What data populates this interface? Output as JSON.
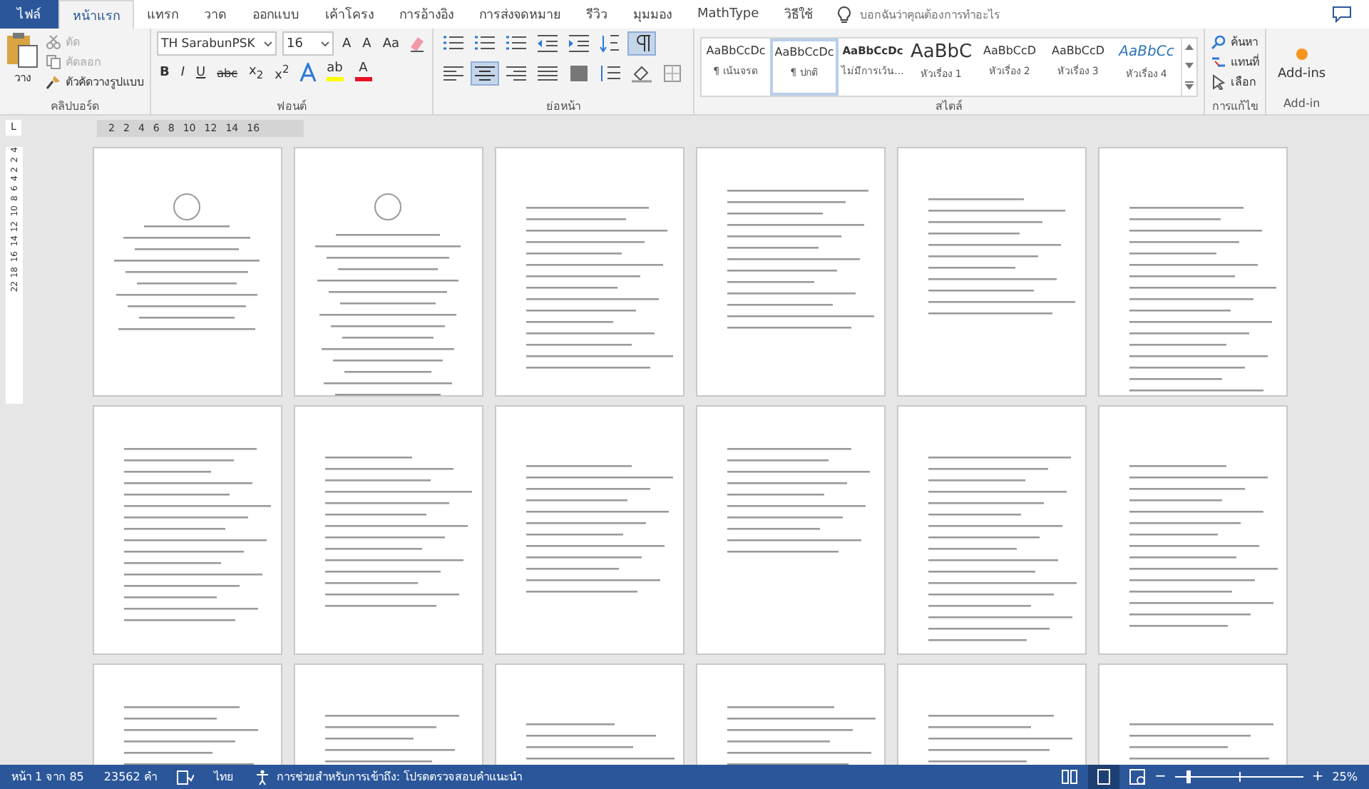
{
  "tabs": [
    {
      "label": "ไฟล์",
      "kind": "file",
      "selected": false
    },
    {
      "label": "หน้าแรก",
      "kind": "tab",
      "selected": true
    },
    {
      "label": "แทรก",
      "kind": "tab",
      "selected": false
    },
    {
      "label": "วาด",
      "kind": "tab",
      "selected": false
    },
    {
      "label": "ออกแบบ",
      "kind": "tab",
      "selected": false
    },
    {
      "label": "เค้าโครง",
      "kind": "tab",
      "selected": false
    },
    {
      "label": "การอ้างอิง",
      "kind": "tab",
      "selected": false
    },
    {
      "label": "การส่งจดหมาย",
      "kind": "tab",
      "selected": false
    },
    {
      "label": "รีวิว",
      "kind": "tab",
      "selected": false
    },
    {
      "label": "มุมมอง",
      "kind": "tab",
      "selected": false
    },
    {
      "label": "MathType",
      "kind": "tab",
      "selected": false
    },
    {
      "label": "วิธีใช้",
      "kind": "tab",
      "selected": false
    }
  ],
  "tell_me": {
    "placeholder": "บอกฉันว่าคุณต้องการทำอะไร"
  },
  "clipboard": {
    "paste": "วาง",
    "items": [
      {
        "label": "ตัด",
        "kind": "cut",
        "disabled": true
      },
      {
        "label": "คัดลอก",
        "kind": "copy",
        "disabled": true
      },
      {
        "label": "ตัวคัดวางรูปแบบ",
        "kind": "painter",
        "disabled": false
      }
    ],
    "label": "คลิปบอร์ด"
  },
  "font": {
    "name": "TH SarabunPSK",
    "size": "16",
    "row1": [
      "A",
      "A",
      "Aa"
    ],
    "row2": [
      "B",
      "I",
      "U",
      "abc",
      "x$_{2}$",
      "x$^{2}$"
    ],
    "colors": [
      {
        "label": "ab",
        "color": "#ffff00"
      },
      {
        "label": "A",
        "color": "#e81123"
      }
    ],
    "label": "ฟอนต์"
  },
  "paragraph": {
    "row1": [
      {
        "kind": "bullets",
        "selected": false
      },
      {
        "kind": "numbering",
        "selected": false
      },
      {
        "kind": "multilevel",
        "selected": false
      },
      {
        "kind": "outdent",
        "selected": false
      },
      {
        "kind": "indent",
        "selected": false
      },
      {
        "kind": "sort",
        "selected": false
      },
      {
        "kind": "pilcrow",
        "selected": true
      }
    ],
    "row2": [
      {
        "kind": "left",
        "selected": false
      },
      {
        "kind": "center",
        "selected": true
      },
      {
        "kind": "right",
        "selected": false
      },
      {
        "kind": "justify",
        "selected": false
      },
      {
        "kind": "distributed",
        "selected": false
      },
      {
        "kind": "spacing",
        "selected": false
      },
      {
        "kind": "shading",
        "selected": false
      },
      {
        "kind": "borders",
        "selected": false
      }
    ],
    "label": "ย่อหน้า"
  },
  "styles": {
    "items": [
      {
        "preview": "AaBbCcDc",
        "name": "¶ เน้นจรด",
        "kind": "normal",
        "selected": false
      },
      {
        "preview": "AaBbCcDc",
        "name": "¶ ปกติ",
        "kind": "normal",
        "selected": true
      },
      {
        "preview": "AaBbCcDc",
        "name": "ไม่มีการเว้น...",
        "kind": "bold",
        "selected": false
      },
      {
        "preview": "AaBbC",
        "name": "หัวเรื่อง 1",
        "kind": "large",
        "selected": false
      },
      {
        "preview": "AaBbCcD",
        "name": "หัวเรื่อง 2",
        "kind": "normal",
        "selected": false
      },
      {
        "preview": "AaBbCcD",
        "name": "หัวเรื่อง 3",
        "kind": "normal",
        "selected": false
      },
      {
        "preview": "AaBbCc",
        "name": "หัวเรื่อง 4",
        "kind": "italic",
        "selected": false
      }
    ],
    "label": "สไตล์"
  },
  "editing": {
    "items": [
      {
        "label": "ค้นหา",
        "kind": "find"
      },
      {
        "label": "แทนที่",
        "kind": "replace"
      },
      {
        "label": "เลือก",
        "kind": "select"
      }
    ],
    "label": "การแก้ไข"
  },
  "addins": {
    "button": "Add-ins",
    "label": "Add-in"
  },
  "ruler": {
    "tab_selector": "L",
    "marks": [
      "2",
      "2",
      "4",
      "6",
      "8",
      "10",
      "12",
      "14",
      "16"
    ],
    "vertical_marks": [
      "4",
      "2",
      "2",
      "4",
      "6",
      "8",
      "10",
      "12",
      "14",
      "16",
      "18",
      "22"
    ]
  },
  "status_bar": {
    "page": "หน้า 1 จาก 85",
    "words": "23562 คำ",
    "language": "ไทย",
    "accessibility": "การช่วยสำหรับการเข้าถึง: โปรดตรวจสอบคำแนะนำ",
    "views": [
      {
        "kind": "read",
        "selected": false
      },
      {
        "kind": "print",
        "selected": true
      },
      {
        "kind": "web",
        "selected": false
      }
    ],
    "zoom": {
      "out": "−",
      "in": "+",
      "level": 0.1,
      "reading": "25%"
    }
  }
}
